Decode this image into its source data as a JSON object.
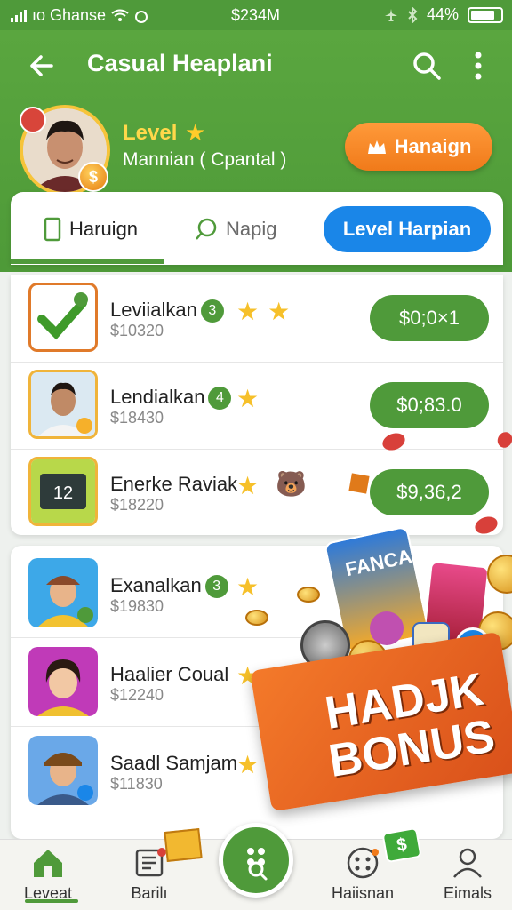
{
  "status_bar": {
    "carrier": "ıo Ghanse",
    "center_text": "$234M",
    "battery": "44%"
  },
  "header": {
    "title": "Casual Heaplani",
    "level_label": "Level",
    "user_name": "Mannian ( Cpantal )",
    "action_label": "Hanaign"
  },
  "tabs": [
    {
      "label": "Haruign"
    },
    {
      "label": "Napig"
    },
    {
      "label": "Level Harpian"
    }
  ],
  "list_top": [
    {
      "name": "Leviialkan",
      "level": "3",
      "price": "$10320",
      "stars": 2,
      "amount": "$0;0×1",
      "thumb": "check-icon"
    },
    {
      "name": "Lendialkan",
      "level": "4",
      "price": "$18430",
      "stars": 1,
      "amount": "$0;83.0",
      "thumb": "avatar"
    },
    {
      "name": "Enerke Raviak",
      "level": "",
      "price": "$18220",
      "stars": 1,
      "amount": "$9,36,2",
      "thumb": "game-icon"
    }
  ],
  "list_bottom": [
    {
      "name": "Exanalkan",
      "level": "3",
      "price": "$19830",
      "stars": 1,
      "thumb": "avatar-hat"
    },
    {
      "name": "Haalier Coual",
      "level": "",
      "price": "$12240",
      "stars": 2,
      "thumb": "avatar-woman"
    },
    {
      "name": "Saadl Samjam",
      "level": "",
      "price": "$11830",
      "stars": 1,
      "thumb": "avatar-cap"
    }
  ],
  "promo": {
    "can_label": "FANCAI",
    "line1": "HADJK",
    "line2": "BONUS"
  },
  "bottom_nav": [
    {
      "label": "Leveat",
      "icon": "home-icon"
    },
    {
      "label": "Barilı",
      "icon": "document-icon"
    },
    {
      "label": "",
      "icon": "search-dots-icon"
    },
    {
      "label": "Haiisnan",
      "icon": "game-dots-icon"
    },
    {
      "label": "Eimals",
      "icon": "user-icon"
    }
  ],
  "colors": {
    "primary": "#4f9a3a",
    "accent": "#f07a1a",
    "tab_blue": "#1a86e8",
    "star": "#f6c02a"
  }
}
